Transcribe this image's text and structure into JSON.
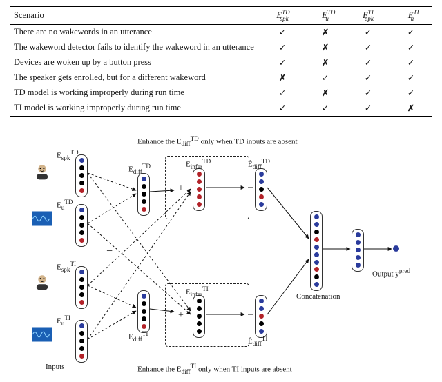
{
  "table": {
    "headers": [
      "Scenario",
      "E_{spk}^{TD}",
      "E_{u}^{TD}",
      "E_{spk}^{TI}",
      "E_{u}^{TI}"
    ],
    "rows": [
      {
        "scenario": "There are no wakewords in an utterance",
        "marks": [
          "check",
          "cross",
          "check",
          "check"
        ]
      },
      {
        "scenario": "The wakeword detector fails to identify the wakeword in an utterance",
        "marks": [
          "check",
          "cross",
          "check",
          "check"
        ]
      },
      {
        "scenario": "Devices are woken up by a button press",
        "marks": [
          "check",
          "cross",
          "check",
          "check"
        ]
      },
      {
        "scenario": "The speaker gets enrolled, but for a different wakeword",
        "marks": [
          "cross",
          "check",
          "check",
          "check"
        ]
      },
      {
        "scenario": "TD model is working improperly during run time",
        "marks": [
          "check",
          "cross",
          "check",
          "check"
        ]
      },
      {
        "scenario": "TI model is working improperly during run time",
        "marks": [
          "check",
          "check",
          "check",
          "cross"
        ]
      }
    ]
  },
  "diagram": {
    "caption_top": "Enhance the E_{diff}^{TD} only when TD inputs are absent",
    "caption_bottom": "Enhance the E_{diff}^{TI} only when TI inputs are absent",
    "inputs_label": "Inputs",
    "concat_label": "Concatenation",
    "output_label": "Output y^{pred}",
    "vec_labels": {
      "EspkTD": "E_{spk}^{TD}",
      "EuTD": "E_{u}^{TD}",
      "EspkTI": "E_{spk}^{TI}",
      "EuTI": "E_{u}^{TI}",
      "EdiffTD": "E_{diff}^{TD}",
      "EdiffTI": "E_{diff}^{TI}",
      "EinferTD": "E_{infer}^{TD}",
      "EinferTI": "E_{infer}^{TI}",
      "EhatdiffTD": "Ê_{diff}^{TD}",
      "EhatdiffTI": "Ê_{diff}^{TI}"
    }
  },
  "chart_data": {
    "type": "table",
    "title": "Availability of embeddings under different scenarios",
    "columns": [
      "Scenario",
      "E_spk^TD",
      "E_u^TD",
      "E_spk^TI",
      "E_u^TI"
    ],
    "rows": [
      [
        "There are no wakewords in an utterance",
        true,
        false,
        true,
        true
      ],
      [
        "The wakeword detector fails to identify the wakeword in an utterance",
        true,
        false,
        true,
        true
      ],
      [
        "Devices are woken up by a button press",
        true,
        false,
        true,
        true
      ],
      [
        "The speaker gets enrolled, but for a different wakeword",
        false,
        true,
        true,
        true
      ],
      [
        "TD model is working improperly during run time",
        true,
        false,
        true,
        true
      ],
      [
        "TI model is working improperly during run time",
        true,
        true,
        true,
        false
      ]
    ]
  }
}
